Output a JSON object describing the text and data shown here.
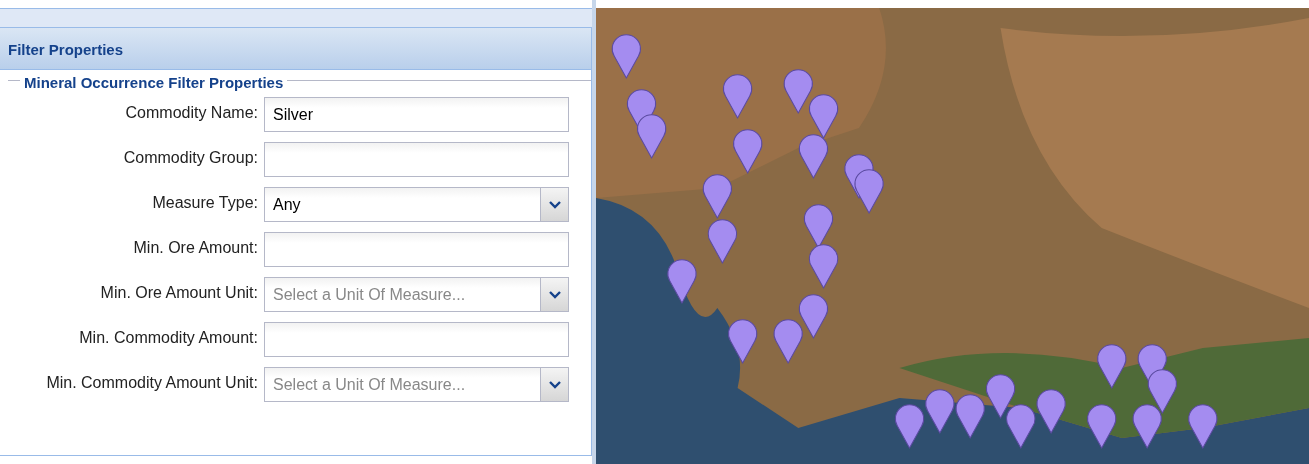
{
  "panel": {
    "title": "Filter Properties"
  },
  "fieldset": {
    "legend": "Mineral Occurrence Filter Properties"
  },
  "fields": [
    {
      "kind": "text",
      "label": "Commodity Name:",
      "value": "Silver"
    },
    {
      "kind": "text",
      "label": "Commodity Group:"
    },
    {
      "kind": "combo",
      "label": "Measure Type:",
      "value": "Any"
    },
    {
      "kind": "text",
      "label": "Min. Ore Amount:"
    },
    {
      "kind": "combo",
      "label": "Min. Ore Amount Unit:",
      "placeholder": "Select a Unit Of Measure..."
    },
    {
      "kind": "text",
      "label": "Min. Commodity Amount:"
    },
    {
      "kind": "combo",
      "label": "Min. Commodity Amount Unit:",
      "placeholder": "Select a Unit Of Measure..."
    }
  ]
}
